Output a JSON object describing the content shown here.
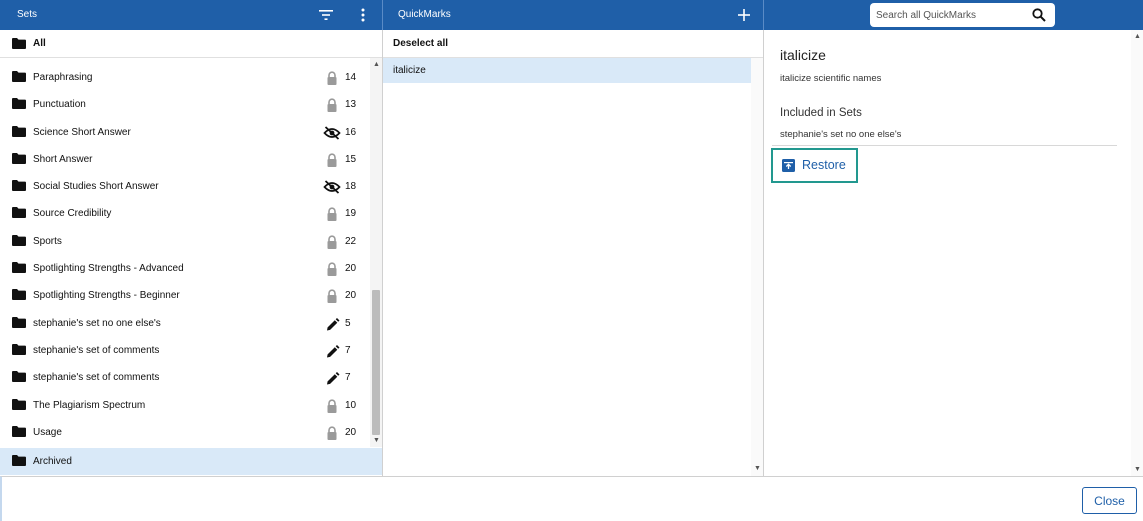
{
  "header": {
    "sets_title": "Sets",
    "filter_icon": "filter-icon",
    "more_icon": "more-vert-icon",
    "quickmarks_title": "QuickMarks",
    "add_icon": "plus-icon",
    "search_placeholder": "Search all QuickMarks",
    "search_icon": "search-icon",
    "brand_color": "#1f5fa8"
  },
  "sets": {
    "all_label": "All",
    "items": [
      {
        "label": "Paraphrasing",
        "status": "lock",
        "count": "14"
      },
      {
        "label": "Punctuation",
        "status": "lock",
        "count": "13"
      },
      {
        "label": "Science Short Answer",
        "status": "hidden",
        "count": "16"
      },
      {
        "label": "Short Answer",
        "status": "lock",
        "count": "15"
      },
      {
        "label": "Social Studies Short Answer",
        "status": "hidden",
        "count": "18"
      },
      {
        "label": "Source Credibility",
        "status": "lock",
        "count": "19"
      },
      {
        "label": "Sports",
        "status": "lock",
        "count": "22"
      },
      {
        "label": "Spotlighting Strengths - Advanced",
        "status": "lock",
        "count": "20"
      },
      {
        "label": "Spotlighting Strengths - Beginner",
        "status": "lock",
        "count": "20"
      },
      {
        "label": "stephanie's set no one else's",
        "status": "edit",
        "count": "5"
      },
      {
        "label": "stephanie's set of comments",
        "status": "edit",
        "count": "7"
      },
      {
        "label": "stephanie's set of comments",
        "status": "edit",
        "count": "7"
      },
      {
        "label": "The Plagiarism Spectrum",
        "status": "lock",
        "count": "10"
      },
      {
        "label": "Usage",
        "status": "lock",
        "count": "20"
      }
    ],
    "archived_label": "Archived"
  },
  "quickmarks": {
    "deselect_label": "Deselect all",
    "items": [
      {
        "label": "italicize",
        "selected": true
      }
    ]
  },
  "detail": {
    "title": "italicize",
    "description": "italicize scientific names",
    "included_heading": "Included in Sets",
    "sets": [
      "stephanie's set no one else's"
    ],
    "restore_label": "Restore",
    "restore_icon": "archive-restore-icon",
    "focus_color": "#22988f"
  },
  "footer": {
    "close_label": "Close"
  }
}
